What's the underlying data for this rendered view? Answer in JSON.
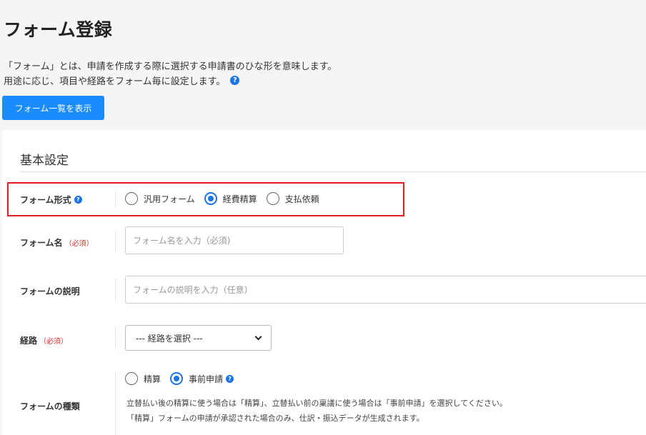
{
  "page": {
    "title": "フォーム登録",
    "description_line1": "「フォーム」とは、申請を作成する際に選択する申請書のひな形を意味します。",
    "description_line2": "用途に応じ、項目や経路をフォーム毎に設定します。",
    "list_button_label": "フォーム一覧を表示"
  },
  "section": {
    "title": "基本設定"
  },
  "form_type": {
    "label": "フォーム形式",
    "options": [
      {
        "label": "汎用フォーム",
        "checked": false
      },
      {
        "label": "経費精算",
        "checked": true
      },
      {
        "label": "支払依頼",
        "checked": false
      }
    ]
  },
  "form_name": {
    "label": "フォーム名",
    "required": "（必須）",
    "placeholder": "フォーム名を入力（必須)"
  },
  "form_description": {
    "label": "フォームの説明",
    "placeholder": "フォームの説明を入力（任意）"
  },
  "route": {
    "label": "経路",
    "required": "（必須）",
    "selected": "--- 経路を選択 ---"
  },
  "form_kind": {
    "label": "フォームの種類",
    "options": [
      {
        "label": "精算",
        "checked": false
      },
      {
        "label": "事前申請",
        "checked": true
      }
    ],
    "hint_line1": "立替払い後の精算に使う場合は「精算」、立替払い前の稟議に使う場合は「事前申請」を選択してください。",
    "hint_line2": "「精算」フォームの申請が承認された場合のみ、仕訳・振込データが生成されます。"
  },
  "icons": {
    "help": "?"
  },
  "colors": {
    "accent": "#1a73e8",
    "button": "#1a8cff",
    "required": "#d9342b",
    "highlight": "#e02020"
  }
}
